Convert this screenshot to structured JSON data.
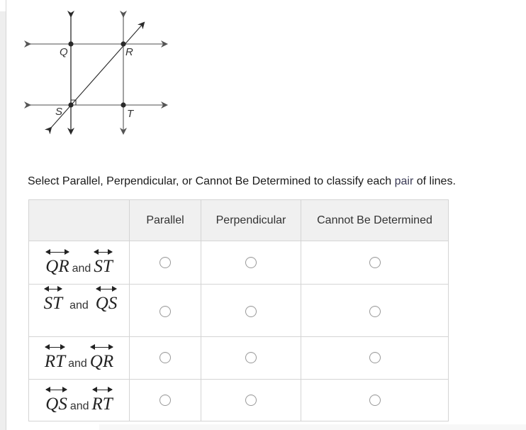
{
  "figure": {
    "points": [
      {
        "label": "Q"
      },
      {
        "label": "R"
      },
      {
        "label": "S"
      },
      {
        "label": "T"
      }
    ],
    "right_angle_at": "S"
  },
  "prompt": {
    "before": "Select Parallel, Perpendicular, or Cannot Be Determined to classify each ",
    "highlight": "pair",
    "after": " of lines."
  },
  "table": {
    "columns": [
      "",
      "Parallel",
      "Perpendicular",
      "Cannot Be Determined"
    ],
    "rows": [
      {
        "first": "QR",
        "connector": "and",
        "second": "ST",
        "selected": null
      },
      {
        "first": "ST",
        "connector": "and",
        "second": "QS",
        "selected": null
      },
      {
        "first": "RT",
        "connector": "and",
        "second": "QR",
        "selected": null
      },
      {
        "first": "QS",
        "connector": "and",
        "second": "RT",
        "selected": null
      }
    ]
  },
  "colors": {
    "line_dark": "#222222",
    "line_gray": "#7a7a7a",
    "header_bg": "#f0f0f0",
    "border": "#d4d4d4"
  }
}
